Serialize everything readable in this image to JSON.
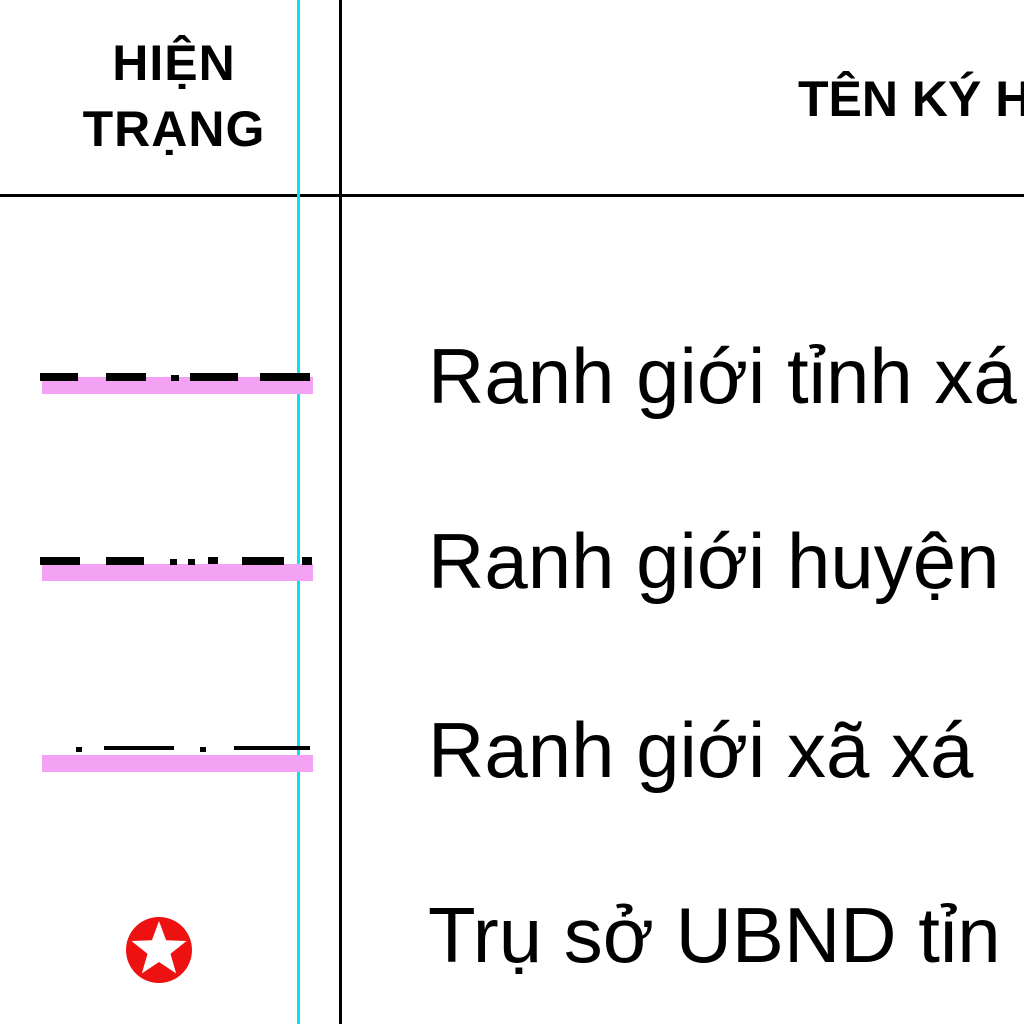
{
  "header": {
    "status_line1": "HIỆN",
    "status_line2": "TRẠNG",
    "name_column": "TÊN KÝ H"
  },
  "legend": {
    "rows": [
      {
        "symbol": "provincial-boundary-line",
        "label": "Ranh giới tỉnh xá"
      },
      {
        "symbol": "district-boundary-line",
        "label": "Ranh giới huyện"
      },
      {
        "symbol": "commune-boundary-line",
        "label": "Ranh giới xã  xá"
      },
      {
        "symbol": "star-circle-icon",
        "label": "Trụ sở UBND tỉn"
      }
    ]
  },
  "colors": {
    "highlight": "#f4a3f4",
    "guide": "#00e5ee",
    "star_badge": "#ee1111",
    "text": "#000000"
  }
}
